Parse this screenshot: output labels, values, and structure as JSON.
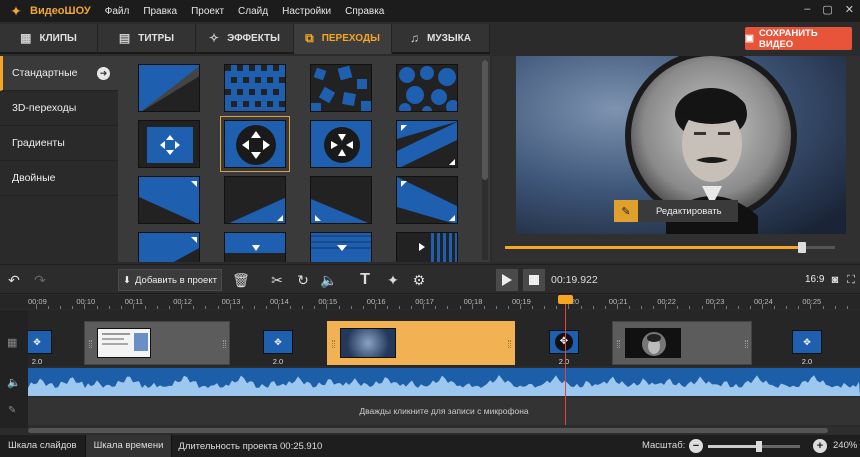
{
  "titlebar": {
    "app_title": "ВидеоШОУ",
    "menu": [
      "Файл",
      "Правка",
      "Проект",
      "Слайд",
      "Настройки",
      "Справка"
    ],
    "controls": [
      "–",
      "▢",
      "✕"
    ]
  },
  "tabs": [
    {
      "label": "КЛИПЫ",
      "icon": "film-icon"
    },
    {
      "label": "ТИТРЫ",
      "icon": "text-bubble-icon"
    },
    {
      "label": "ЭФФЕКТЫ",
      "icon": "magic-wand-icon"
    },
    {
      "label": "ПЕРЕХОДЫ",
      "icon": "transition-icon",
      "active": true
    },
    {
      "label": "МУЗЫКА",
      "icon": "music-note-icon"
    }
  ],
  "save_button": {
    "label": "СОХРАНИТЬ ВИДЕО"
  },
  "categories": [
    {
      "label": "Стандартные",
      "active": true
    },
    {
      "label": "3D-переходы"
    },
    {
      "label": "Градиенты"
    },
    {
      "label": "Двойные"
    }
  ],
  "preview": {
    "edit_label": "Редактировать",
    "progress": 0.9
  },
  "toolbar": {
    "add_label": "Добавить в проект",
    "timecode": "00:19.922",
    "aspect": "16:9"
  },
  "ruler": {
    "ticks": [
      "00:09",
      "00:10",
      "00:11",
      "00:12",
      "00:13",
      "00:14",
      "00:15",
      "00:16",
      "00:17",
      "00:18",
      "00:19",
      "00:20",
      "00:21",
      "00:22",
      "00:23",
      "00:24",
      "00:25"
    ]
  },
  "timeline": {
    "transition_duration": "2.0",
    "mic_hint": "Дважды кликните для записи с микрофона"
  },
  "status": {
    "slides_tab": "Шкала слайдов",
    "timeline_tab": "Шкала времени",
    "duration": "Длительность проекта 00:25.910",
    "zoom_label": "Масштаб:",
    "zoom_value": "240%",
    "zoom_level": 0.55
  },
  "colors": {
    "accent": "#f5a623",
    "save": "#e8543a",
    "transition_blue": "#1e5fb0"
  }
}
